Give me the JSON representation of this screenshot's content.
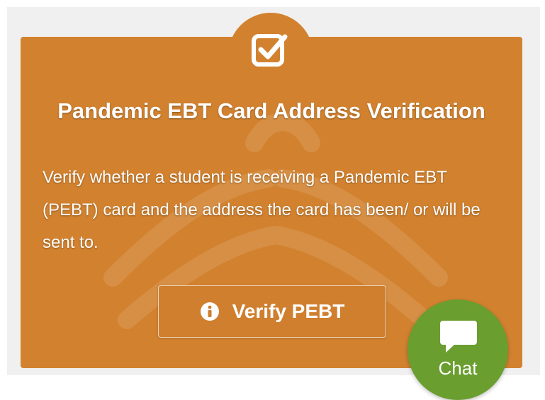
{
  "card": {
    "title": "Pandemic EBT Card Address Verification",
    "description": "Verify whether a student is receiving a Pandemic EBT (PEBT) card and the address the card has been/ or will be sent to.",
    "button_label": "Verify PEBT",
    "accent_color": "#d2822f",
    "icon": "check-square-icon",
    "button_icon": "info-circle-icon"
  },
  "chat": {
    "label": "Chat",
    "color": "#6a9e2f",
    "icon": "chat-bubble-icon"
  }
}
